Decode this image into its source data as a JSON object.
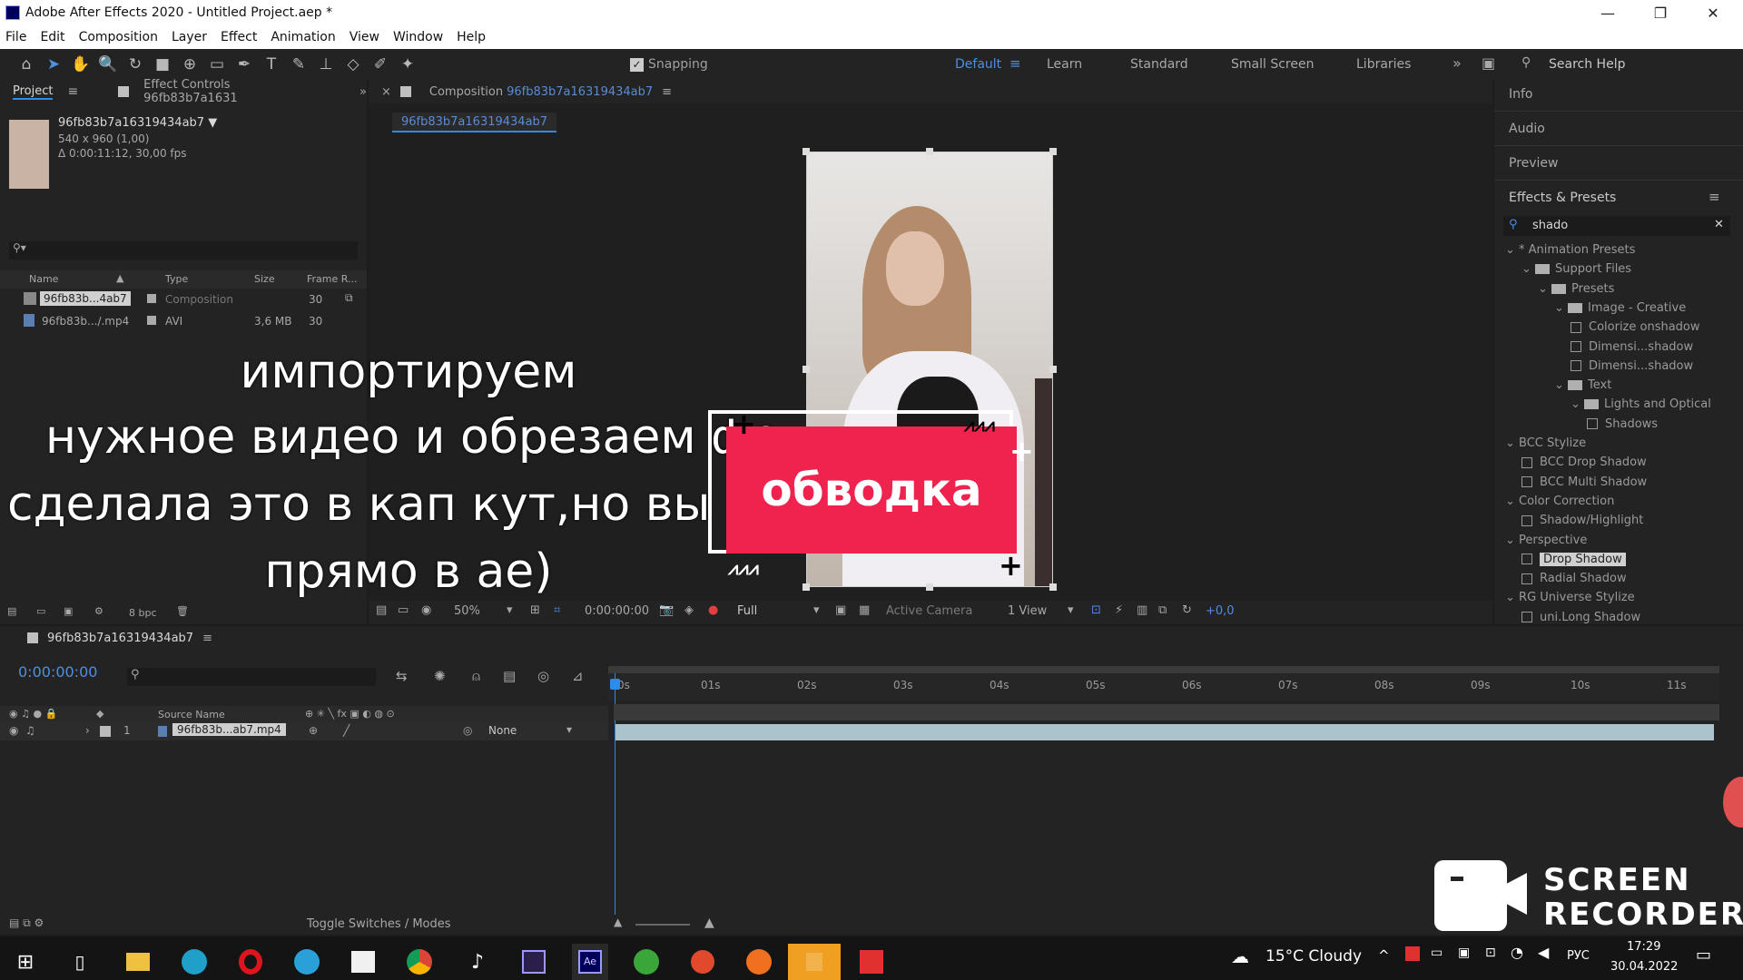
{
  "window": {
    "title": "Adobe After Effects 2020 - Untitled Project.aep *",
    "minimize": "—",
    "maximize": "❐",
    "close": "✕"
  },
  "menu": [
    "File",
    "Edit",
    "Composition",
    "Layer",
    "Effect",
    "Animation",
    "View",
    "Window",
    "Help"
  ],
  "toolbar": {
    "snapping": "Snapping",
    "workspaces": [
      "Default",
      "Learn",
      "Standard",
      "Small Screen",
      "Libraries"
    ],
    "search_placeholder": "Search Help"
  },
  "project": {
    "tab": "Project",
    "effect_controls": "Effect Controls 96fb83b7a1631",
    "item_name": "96fb83b7a16319434ab7 ▼",
    "item_dims": "540 x 960 (1,00)",
    "item_dur": "Δ 0:00:11:12, 30,00 fps",
    "columns": [
      "Name",
      "Type",
      "Size",
      "Frame R..."
    ],
    "rows": [
      {
        "name": "96fb83b...4ab7",
        "type": "Composition",
        "size": "",
        "fps": "30"
      },
      {
        "name": "96fb83b.../.mp4",
        "type": "AVI",
        "size": "3,6 MB",
        "fps": "30"
      }
    ],
    "bpc": "8 bpc"
  },
  "composition": {
    "tab_prefix": "Composition",
    "tab_name": "96fb83b7a16319434ab7",
    "subtab": "96fb83b7a16319434ab7",
    "zoom": "50%",
    "time": "0:00:00:00",
    "quality": "Full",
    "camera": "Active Camera",
    "views": "1 View",
    "exposure": "+0,0"
  },
  "subtitles": [
    "импортируем",
    "нужное видео и обрезаем фо",
    "сделала это в кап кут,но вы мо",
    "прямо в ае)"
  ],
  "sticker_text": "обводка",
  "right_panels": [
    "Info",
    "Audio",
    "Preview",
    "Effects & Presets"
  ],
  "effects_search": "shado",
  "effects_tree": [
    {
      "label": "* Animation Presets",
      "indent": 0,
      "kind": "group"
    },
    {
      "label": "Support Files",
      "indent": 1,
      "kind": "folder"
    },
    {
      "label": "Presets",
      "indent": 2,
      "kind": "folder"
    },
    {
      "label": "Image - Creative",
      "indent": 3,
      "kind": "folder"
    },
    {
      "label": "Colorize onshadow",
      "indent": 4,
      "kind": "fx"
    },
    {
      "label": "Dimensi...shadow",
      "indent": 4,
      "kind": "fx"
    },
    {
      "label": "Dimensi...shadow",
      "indent": 4,
      "kind": "fx"
    },
    {
      "label": "Text",
      "indent": 3,
      "kind": "folder"
    },
    {
      "label": "Lights and Optical",
      "indent": 4,
      "kind": "folder"
    },
    {
      "label": "Shadows",
      "indent": 5,
      "kind": "fx"
    },
    {
      "label": "BCC Stylize",
      "indent": 0,
      "kind": "group"
    },
    {
      "label": "BCC Drop Shadow",
      "indent": 1,
      "kind": "fx"
    },
    {
      "label": "BCC Multi Shadow",
      "indent": 1,
      "kind": "fx"
    },
    {
      "label": "Color Correction",
      "indent": 0,
      "kind": "group"
    },
    {
      "label": "Shadow/Highlight",
      "indent": 1,
      "kind": "fx"
    },
    {
      "label": "Perspective",
      "indent": 0,
      "kind": "group"
    },
    {
      "label": "Drop Shadow",
      "indent": 1,
      "kind": "fx",
      "selected": true
    },
    {
      "label": "Radial Shadow",
      "indent": 1,
      "kind": "fx"
    },
    {
      "label": "RG Universe Stylize",
      "indent": 0,
      "kind": "group"
    },
    {
      "label": "uni.Long Shadow",
      "indent": 1,
      "kind": "fx"
    }
  ],
  "timeline": {
    "comp_name": "96fb83b7a16319434ab7",
    "timecode": "0:00:00:00",
    "source_name_header": "Source Name",
    "ticks": [
      "0s",
      "01s",
      "02s",
      "03s",
      "04s",
      "05s",
      "06s",
      "07s",
      "08s",
      "09s",
      "10s",
      "11s"
    ],
    "layer": {
      "index": "1",
      "name": "96fb83b...ab7.mp4",
      "parent": "None"
    },
    "toggle": "Toggle Switches / Modes"
  },
  "recorder": {
    "line1": "SCREEN",
    "line2": "RECORDER"
  },
  "taskbar": {
    "weather": "15°C  Cloudy",
    "lang": "РУС",
    "time": "17:29",
    "date": "30.04.2022"
  },
  "colors": {
    "accent": "#2d8ceb",
    "sticker": "#f0224e",
    "selected": "#d0d0d0"
  }
}
